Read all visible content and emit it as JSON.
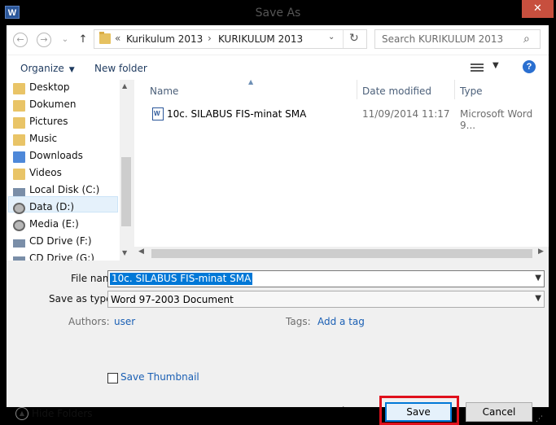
{
  "window": {
    "title": "Save As",
    "app_icon_letter": "W",
    "close_glyph": "✕"
  },
  "nav": {
    "back_glyph": "←",
    "forward_glyph": "→",
    "dropdown_glyph": "⌄",
    "up_glyph": "↑",
    "breadcrumb_overflow": "«",
    "breadcrumb": [
      "Kurikulum 2013",
      "KURIKULUM 2013"
    ],
    "breadcrumb_sep": "›",
    "address_dropdown_glyph": "⌄",
    "refresh_glyph": "↻",
    "search_placeholder": "Search KURIKULUM 2013",
    "search_glyph": "⌕"
  },
  "toolbar": {
    "organize_label": "Organize",
    "new_folder_label": "New folder",
    "help_glyph": "?"
  },
  "sidebar": {
    "items": [
      {
        "label": "Desktop",
        "icon": "desktop-folder-icon"
      },
      {
        "label": "Dokumen",
        "icon": "documents-folder-icon"
      },
      {
        "label": "Pictures",
        "icon": "pictures-folder-icon"
      },
      {
        "label": "Music",
        "icon": "music-folder-icon"
      },
      {
        "label": "Downloads",
        "icon": "downloads-folder-icon"
      },
      {
        "label": "Videos",
        "icon": "videos-folder-icon"
      },
      {
        "label": "Local Disk (C:)",
        "icon": "local-disk-icon"
      },
      {
        "label": "Data (D:)",
        "icon": "disk-icon"
      },
      {
        "label": "Media (E:)",
        "icon": "disk-icon"
      },
      {
        "label": "CD Drive (F:)",
        "icon": "cd-drive-icon"
      },
      {
        "label": "CD Drive (G:)",
        "icon": "cd-drive-icon"
      }
    ],
    "selected_index": 7
  },
  "files": {
    "columns": [
      "Name",
      "Date modified",
      "Type"
    ],
    "rows": [
      {
        "name": "10c. SILABUS FIS-minat SMA",
        "date": "11/09/2014 11:17",
        "type": "Microsoft Word 9..."
      }
    ]
  },
  "form": {
    "file_name_label": "File name:",
    "file_name_value": "10c. SILABUS FIS-minat SMA",
    "save_as_type_label": "Save as type:",
    "save_as_type_value": "Word 97-2003 Document",
    "authors_label": "Authors:",
    "authors_value": "user",
    "tags_label": "Tags:",
    "tags_value": "Add a tag",
    "save_thumbnail_label": "Save Thumbnail",
    "hide_folders_label": "Hide Folders",
    "tools_label": "Tools",
    "save_label": "Save",
    "cancel_label": "Cancel"
  },
  "colors": {
    "highlight": "#e0101c",
    "accent": "#0078d7",
    "close": "#c74f3e"
  }
}
